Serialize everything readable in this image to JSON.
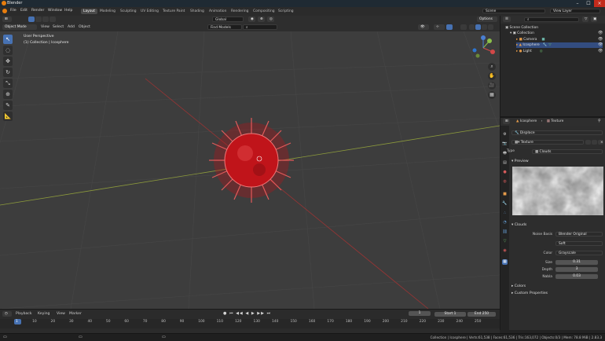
{
  "window": {
    "title": "Blender"
  },
  "menu": [
    "File",
    "Edit",
    "Render",
    "Window",
    "Help"
  ],
  "workspaces": [
    "Layout",
    "Modeling",
    "Sculpting",
    "UV Editing",
    "Texture Paint",
    "Shading",
    "Animation",
    "Rendering",
    "Compositing",
    "Scripting"
  ],
  "scene": {
    "name": "Scene",
    "view_layer": "View Layer"
  },
  "viewport_header": {
    "mode": "Object Mode",
    "menus": [
      "View",
      "Select",
      "Add",
      "Object"
    ],
    "orientation": "Global",
    "search_value": "Find Models",
    "options": "Options"
  },
  "viewport": {
    "info_line1": "User Perspective",
    "info_line2": "(1) Collection | Icosphere"
  },
  "gizmo": {
    "x": "X",
    "y": "Y",
    "z": "Z"
  },
  "outliner": {
    "root": "Scene Collection",
    "collection": "Collection",
    "items": [
      "Camera",
      "Icosphere",
      "Light"
    ]
  },
  "properties": {
    "breadcrumb_object": "Icosphere",
    "breadcrumb_texture": "Texture",
    "modifier": "Displace",
    "texture_name": "Texture",
    "type_label": "Type",
    "type_value": "Clouds",
    "preview_label": "Preview",
    "clouds_label": "Clouds",
    "noise_basis_label": "Noise Basis",
    "noise_basis_value": "Blender Original",
    "noise_type_value": "Soft",
    "color_label": "Color",
    "color_value": "Grayscale",
    "size_label": "Size",
    "size_value": "0.31",
    "depth_label": "Depth",
    "depth_value": "3",
    "nabla_label": "Nabla",
    "nabla_value": "0.03",
    "colors_label": "Colors",
    "custom_props_label": "Custom Properties"
  },
  "timeline": {
    "menus": [
      "Playback",
      "Keying",
      "View",
      "Marker"
    ],
    "current_frame": "1",
    "start_label": "Start",
    "start_value": "1",
    "end_label": "End",
    "end_value": "250",
    "ticks": [
      "1",
      "10",
      "20",
      "30",
      "40",
      "50",
      "60",
      "70",
      "80",
      "90",
      "100",
      "110",
      "120",
      "130",
      "140",
      "150",
      "160",
      "170",
      "180",
      "190",
      "200",
      "210",
      "220",
      "230",
      "240",
      "250"
    ]
  },
  "status": {
    "text": "Collection | Icosphere | Verts:61,538 | Faces:61,536 | Tris:163,072 | Objects:0/3 | Mem: 78.8 MiB | 2.83.3"
  },
  "colors": {
    "accent": "#4772b3",
    "object_red": "#c0141a",
    "x_axis": "#a33a3a",
    "y_axis": "#8aa34a",
    "header": "#2b2b2b"
  }
}
